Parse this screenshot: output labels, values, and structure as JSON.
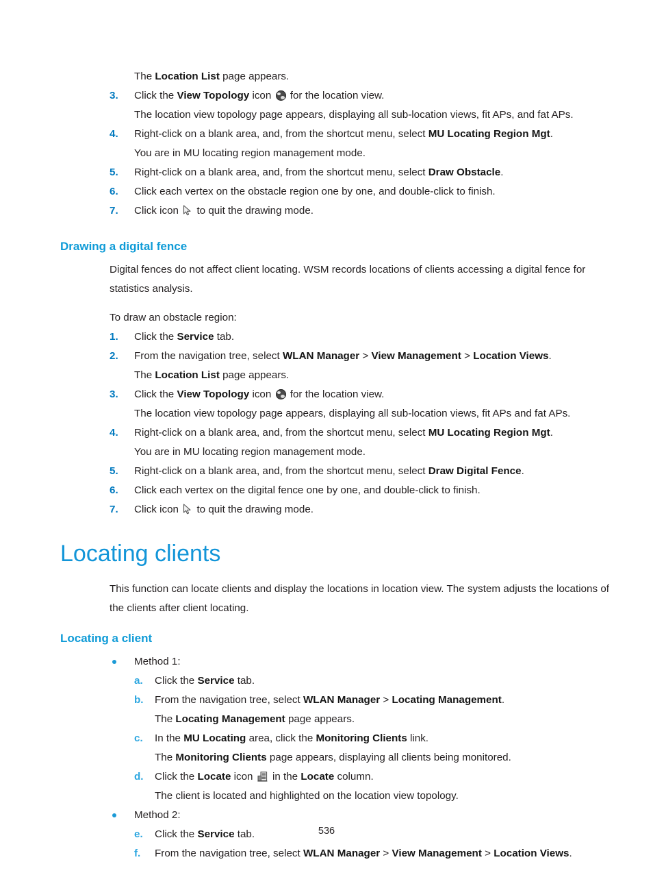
{
  "document": {
    "page_number": "536"
  },
  "icons": {
    "view_topology": "globe-icon",
    "cursor": "cursor-arrow-icon",
    "locate": "building-icon"
  },
  "colors": {
    "heading_blue": "#1295d8",
    "subheading_blue": "#0f9bd7",
    "number_blue": "#0079bf",
    "letter_blue": "#2ba6e0",
    "body_text": "#231f20"
  },
  "section_obstacle_tail": {
    "intro_line": {
      "pre": "The ",
      "bold": "Location List",
      "post": " page appears."
    },
    "steps": [
      {
        "marker": "3.",
        "pre": "Click the ",
        "bold": "View Topology",
        "post": " icon ",
        "post2": " for the location view."
      },
      {
        "marker": "4.",
        "pre": "Right-click on a blank area, and, from the shortcut menu, select ",
        "bold": "MU Locating Region Mgt",
        "post": "."
      },
      {
        "marker": "5.",
        "pre": "Right-click on a blank area, and, from the shortcut menu, select ",
        "bold": "Draw Obstacle",
        "post": "."
      },
      {
        "marker": "6.",
        "text": "Click each vertex on the obstacle region one by one, and double-click to finish."
      },
      {
        "marker": "7.",
        "pre": "Click icon ",
        "post": " to quit the drawing mode."
      }
    ],
    "step3_result": "The location view topology page appears, displaying all sub-location views, fit APs, and fat APs."
  },
  "section_digital_fence": {
    "heading": "Drawing a digital fence",
    "paragraph": "Digital fences do not affect client locating. WSM records locations of clients accessing a digital fence for statistics analysis.",
    "lead_in": "To draw an obstacle region:",
    "steps": [
      {
        "marker": "1.",
        "pre": "Click the ",
        "bold": "Service",
        "post": " tab."
      },
      {
        "marker": "2.",
        "pre": "From the navigation tree, select ",
        "bold1": "WLAN Manager",
        "sep1": " > ",
        "bold2": "View Management",
        "sep2": " > ",
        "bold3": "Location Views",
        "post": "."
      },
      {
        "marker": "3.",
        "pre": "Click the ",
        "bold": "View Topology",
        "post": " icon ",
        "post2": " for the location view."
      },
      {
        "marker": "4.",
        "pre": "Right-click on a blank area, and, from the shortcut menu, select ",
        "bold": "MU Locating Region Mgt",
        "post": "."
      },
      {
        "marker": "5.",
        "pre": "Right-click on a blank area, and, from the shortcut menu, select ",
        "bold": "Draw Digital Fence",
        "post": "."
      },
      {
        "marker": "6.",
        "text": "Click each vertex on the digital fence one by one, and double-click to finish."
      },
      {
        "marker": "7.",
        "pre": "Click icon ",
        "post": " to quit the drawing mode."
      }
    ],
    "step2_result": {
      "pre": "The ",
      "bold": "Location List",
      "post": " page appears."
    },
    "step3_result": "The location view topology page appears, displaying all sub-location views, fit APs and fat APs.",
    "step4_result": "You are in MU locating region management mode."
  },
  "section_locating_clients": {
    "heading": "Locating clients",
    "paragraph": "This function can locate clients and display the locations in location view. The system adjusts the locations of the clients after client locating.",
    "subheading": "Locating a client",
    "method1": {
      "label": "Method 1:",
      "steps": [
        {
          "marker": "a.",
          "pre": "Click the ",
          "bold": "Service",
          "post": " tab."
        },
        {
          "marker": "b.",
          "pre": "From the navigation tree, select ",
          "bold1": "WLAN Manager",
          "sep1": " > ",
          "bold2": "Locating Management",
          "post": "."
        },
        {
          "marker": "c.",
          "pre": "In the ",
          "bold1": "MU Locating",
          "mid": " area, click the ",
          "bold2": "Monitoring Clients",
          "post": " link."
        },
        {
          "marker": "d.",
          "pre": "Click the ",
          "bold1": "Locate",
          "mid": " icon ",
          "mid2": " in the ",
          "bold2": "Locate",
          "post": " column."
        }
      ],
      "result_b": {
        "pre": "The ",
        "bold": "Locating Management",
        "post": " page appears."
      },
      "result_c": {
        "pre": "The ",
        "bold": "Monitoring Clients",
        "post": " page appears, displaying all clients being monitored."
      },
      "result_d": "The client is located and highlighted on the location view topology."
    },
    "method2": {
      "label": "Method 2:",
      "steps": [
        {
          "marker": "e.",
          "pre": "Click the ",
          "bold": "Service",
          "post": " tab."
        },
        {
          "marker": "f.",
          "pre": "From the navigation tree, select ",
          "bold1": "WLAN Manager",
          "sep1": " > ",
          "bold2": "View Management",
          "sep2": " > ",
          "bold3": "Location Views",
          "post": "."
        }
      ]
    }
  }
}
